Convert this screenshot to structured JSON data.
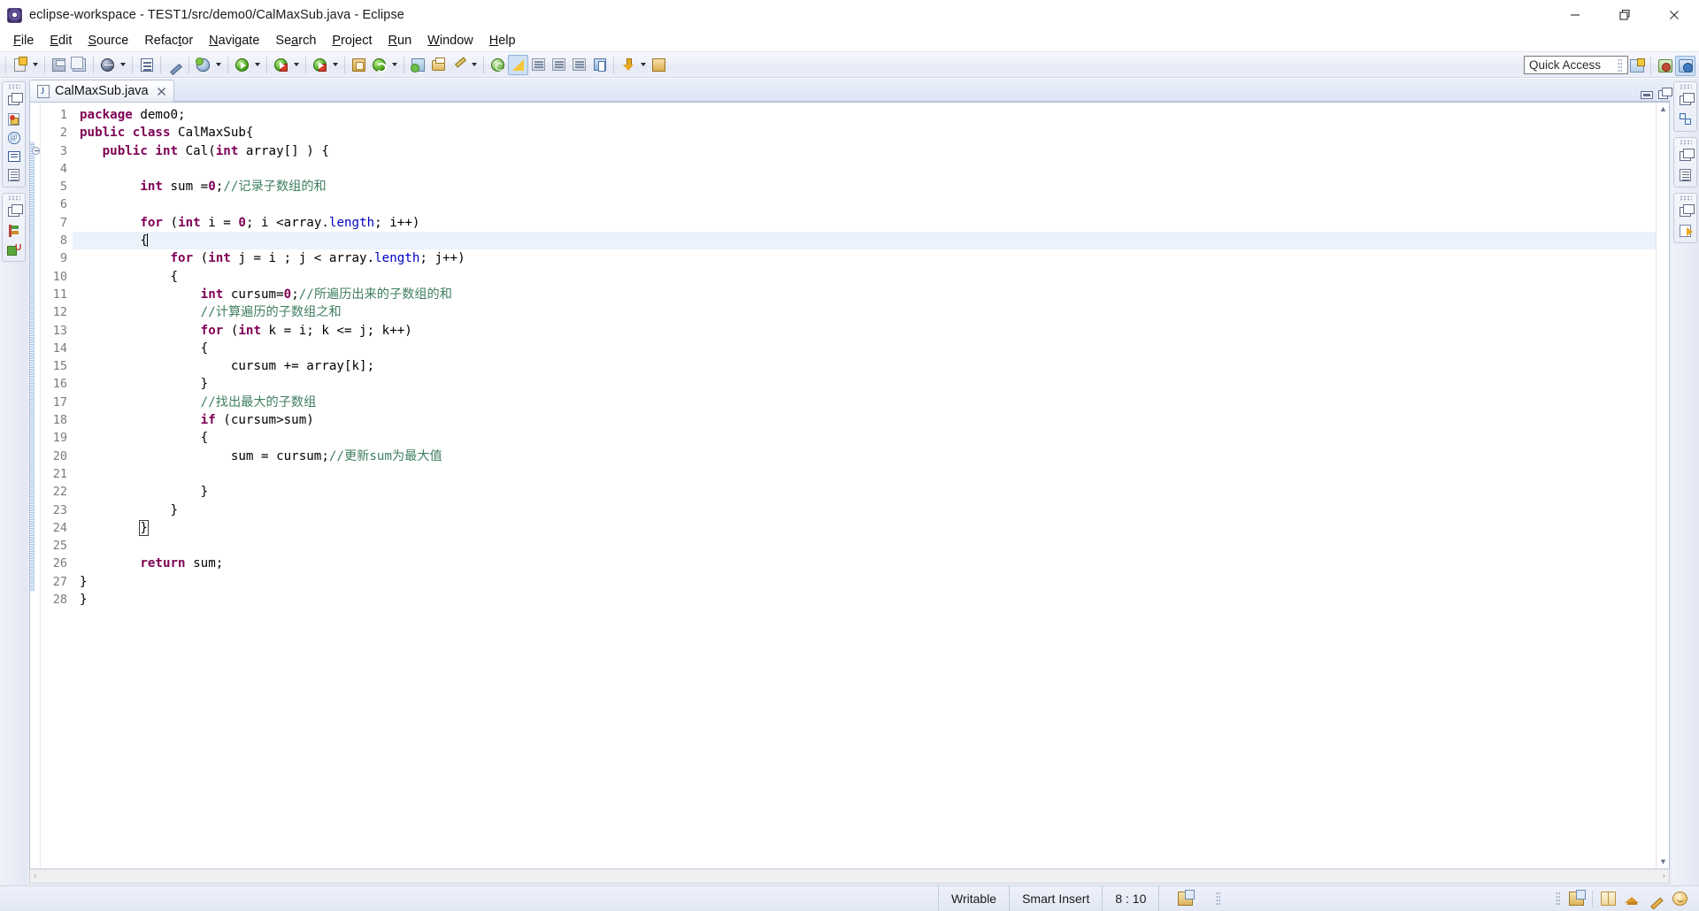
{
  "window": {
    "title": "eclipse-workspace - TEST1/src/demo0/CalMaxSub.java - Eclipse",
    "app_icon": "eclipse-icon",
    "controls": {
      "minimize": "minimize-icon",
      "restore": "restore-icon",
      "close": "close-icon"
    }
  },
  "menubar": {
    "items": [
      {
        "label": "File",
        "mnemonic": "F"
      },
      {
        "label": "Edit",
        "mnemonic": "E"
      },
      {
        "label": "Source",
        "mnemonic": "S"
      },
      {
        "label": "Refactor",
        "mnemonic": "t"
      },
      {
        "label": "Navigate",
        "mnemonic": "N"
      },
      {
        "label": "Search",
        "mnemonic": "a"
      },
      {
        "label": "Project",
        "mnemonic": "P"
      },
      {
        "label": "Run",
        "mnemonic": "R"
      },
      {
        "label": "Window",
        "mnemonic": "W"
      },
      {
        "label": "Help",
        "mnemonic": "H"
      }
    ]
  },
  "toolbar": {
    "buttons": [
      {
        "name": "new-wizard",
        "icon": "new-icon",
        "dropdown": true
      },
      {
        "name": "save",
        "icon": "save-icon",
        "dropdown": false
      },
      {
        "name": "save-all",
        "icon": "save-all-icon",
        "dropdown": false
      },
      {
        "name": "new-java-package-or-globe",
        "icon": "globe-icon",
        "dropdown": true
      },
      {
        "name": "open-type",
        "icon": "document-icon",
        "dropdown": false
      },
      {
        "name": "toggle-mark-occurrences",
        "icon": "pen-icon",
        "dropdown": false
      },
      {
        "name": "debug",
        "icon": "debug-bug-icon",
        "dropdown": true
      },
      {
        "name": "run",
        "icon": "run-green-play-icon",
        "dropdown": true
      },
      {
        "name": "run-coverage",
        "icon": "run-coverage-icon",
        "dropdown": true
      },
      {
        "name": "run-last-tool",
        "icon": "run-external-tools-icon",
        "dropdown": true
      },
      {
        "name": "new-java-project",
        "icon": "new-java-project-icon",
        "dropdown": false
      },
      {
        "name": "open-search",
        "icon": "search-orange-icon",
        "dropdown": true
      },
      {
        "name": "forward-refresh",
        "icon": "refresh-green-icon",
        "dropdown": false
      },
      {
        "name": "new-package",
        "icon": "package-icon",
        "dropdown": false
      },
      {
        "name": "print",
        "icon": "print-icon",
        "dropdown": false
      },
      {
        "name": "brush",
        "icon": "brush-icon",
        "dropdown": true
      },
      {
        "name": "toggle-breadcrumb",
        "icon": "breadcrumb-icon",
        "dropdown": false
      },
      {
        "name": "yellow-triangle-warning",
        "icon": "warning-triangle-icon",
        "dropdown": false
      },
      {
        "name": "skip-breakpoints",
        "icon": "skip-breakpoints-icon",
        "dropdown": false
      },
      {
        "name": "next-annotation",
        "icon": "next-annotation-icon",
        "dropdown": false
      },
      {
        "name": "previous-annotation",
        "icon": "previous-annotation-icon",
        "dropdown": false
      },
      {
        "name": "last-edit-location",
        "icon": "last-edit-location-icon",
        "dropdown": false
      },
      {
        "name": "back-history",
        "icon": "back-arrow-icon",
        "dropdown": true
      },
      {
        "name": "forward-history",
        "icon": "forward-arrow-icon",
        "dropdown": true
      }
    ],
    "quick_access": {
      "placeholder": "Quick Access",
      "value": "Quick Access"
    },
    "perspective_buttons": [
      {
        "name": "open-perspective",
        "icon": "open-perspective-icon"
      },
      {
        "name": "java-ee-perspective",
        "icon": "java-ee-perspective-icon"
      },
      {
        "name": "java-perspective",
        "icon": "java-perspective-icon",
        "selected": true
      }
    ]
  },
  "left_trim": {
    "stacks": [
      {
        "name": "package-explorer-stack",
        "items": [
          {
            "name": "restore-icon"
          },
          {
            "name": "package-explorer-icon"
          },
          {
            "name": "javadoc-icon"
          },
          {
            "name": "console-icon"
          },
          {
            "name": "outline-icon"
          }
        ]
      },
      {
        "name": "task-list-stack",
        "items": [
          {
            "name": "restore-icon"
          },
          {
            "name": "task-list-icon"
          },
          {
            "name": "junit-icon"
          }
        ]
      }
    ]
  },
  "right_trim": {
    "stacks": [
      {
        "name": "outline-stack",
        "items": [
          {
            "name": "restore-icon"
          },
          {
            "name": "type-hierarchy-icon"
          }
        ]
      },
      {
        "name": "problems-stack",
        "items": [
          {
            "name": "restore-icon"
          },
          {
            "name": "problems-icon"
          }
        ]
      },
      {
        "name": "export-stack",
        "items": [
          {
            "name": "restore-icon"
          },
          {
            "name": "export-icon"
          }
        ]
      }
    ]
  },
  "editor": {
    "tab": {
      "label": "CalMaxSub.java",
      "icon": "java-file-icon",
      "close": "✖",
      "dirty": false
    },
    "controls": {
      "minimize": "minimize-editor-icon",
      "maximize": "maximize-editor-icon"
    },
    "overview_ruler": {
      "up_arrow": "▲",
      "down_arrow": "▼"
    },
    "hscroll": {
      "left_arrow": "‹",
      "right_arrow": "›"
    },
    "current_line": 8,
    "caret_column": 10,
    "fold_marker_line": 3,
    "bracket_match_line": 24,
    "lines": [
      {
        "n": 1,
        "tokens": [
          {
            "t": "package",
            "c": "kw"
          },
          {
            "t": " demo0;",
            "c": "pln"
          }
        ]
      },
      {
        "n": 2,
        "tokens": [
          {
            "t": "public class",
            "c": "kw"
          },
          {
            "t": " CalMaxSub{",
            "c": "pln"
          }
        ]
      },
      {
        "n": 3,
        "tokens": [
          {
            "t": "   ",
            "c": "pln"
          },
          {
            "t": "public int",
            "c": "kw"
          },
          {
            "t": " Cal(",
            "c": "pln"
          },
          {
            "t": "int",
            "c": "kw"
          },
          {
            "t": " array[] ) {",
            "c": "pln"
          }
        ]
      },
      {
        "n": 4,
        "tokens": []
      },
      {
        "n": 5,
        "tokens": [
          {
            "t": "        ",
            "c": "pln"
          },
          {
            "t": "int",
            "c": "kw"
          },
          {
            "t": " sum =",
            "c": "pln"
          },
          {
            "t": "0",
            "c": "kw"
          },
          {
            "t": ";",
            "c": "pln"
          },
          {
            "t": "//记录子数组的和",
            "c": "cm"
          }
        ]
      },
      {
        "n": 6,
        "tokens": []
      },
      {
        "n": 7,
        "tokens": [
          {
            "t": "        ",
            "c": "pln"
          },
          {
            "t": "for",
            "c": "kw"
          },
          {
            "t": " (",
            "c": "pln"
          },
          {
            "t": "int",
            "c": "kw"
          },
          {
            "t": " i = ",
            "c": "pln"
          },
          {
            "t": "0",
            "c": "kw"
          },
          {
            "t": "; i <array.",
            "c": "pln"
          },
          {
            "t": "length",
            "c": "fld"
          },
          {
            "t": "; i++)",
            "c": "pln"
          }
        ]
      },
      {
        "n": 8,
        "tokens": [
          {
            "t": "        {",
            "c": "pln"
          }
        ],
        "caret_after": true,
        "current": true
      },
      {
        "n": 9,
        "tokens": [
          {
            "t": "            ",
            "c": "pln"
          },
          {
            "t": "for",
            "c": "kw"
          },
          {
            "t": " (",
            "c": "pln"
          },
          {
            "t": "int",
            "c": "kw"
          },
          {
            "t": " j = i ; j < array.",
            "c": "pln"
          },
          {
            "t": "length",
            "c": "fld"
          },
          {
            "t": "; j++)",
            "c": "pln"
          }
        ]
      },
      {
        "n": 10,
        "tokens": [
          {
            "t": "            {",
            "c": "pln"
          }
        ]
      },
      {
        "n": 11,
        "tokens": [
          {
            "t": "                ",
            "c": "pln"
          },
          {
            "t": "int",
            "c": "kw"
          },
          {
            "t": " cursum=",
            "c": "pln"
          },
          {
            "t": "0",
            "c": "kw"
          },
          {
            "t": ";",
            "c": "pln"
          },
          {
            "t": "//所遍历出来的子数组的和",
            "c": "cm"
          }
        ]
      },
      {
        "n": 12,
        "tokens": [
          {
            "t": "                ",
            "c": "pln"
          },
          {
            "t": "//计算遍历的子数组之和",
            "c": "cm"
          }
        ]
      },
      {
        "n": 13,
        "tokens": [
          {
            "t": "                ",
            "c": "pln"
          },
          {
            "t": "for",
            "c": "kw"
          },
          {
            "t": " (",
            "c": "pln"
          },
          {
            "t": "int",
            "c": "kw"
          },
          {
            "t": " k = i; k <= j; k++)",
            "c": "pln"
          }
        ]
      },
      {
        "n": 14,
        "tokens": [
          {
            "t": "                {",
            "c": "pln"
          }
        ]
      },
      {
        "n": 15,
        "tokens": [
          {
            "t": "                    cursum += array[k];",
            "c": "pln"
          }
        ]
      },
      {
        "n": 16,
        "tokens": [
          {
            "t": "                }",
            "c": "pln"
          }
        ]
      },
      {
        "n": 17,
        "tokens": [
          {
            "t": "                ",
            "c": "pln"
          },
          {
            "t": "//找出最大的子数组",
            "c": "cm"
          }
        ]
      },
      {
        "n": 18,
        "tokens": [
          {
            "t": "                ",
            "c": "pln"
          },
          {
            "t": "if",
            "c": "kw"
          },
          {
            "t": " (cursum>sum)",
            "c": "pln"
          }
        ]
      },
      {
        "n": 19,
        "tokens": [
          {
            "t": "                {",
            "c": "pln"
          }
        ]
      },
      {
        "n": 20,
        "tokens": [
          {
            "t": "                    sum = cursum;",
            "c": "pln"
          },
          {
            "t": "//更新sum为最大值",
            "c": "cm"
          }
        ]
      },
      {
        "n": 21,
        "tokens": []
      },
      {
        "n": 22,
        "tokens": [
          {
            "t": "                }",
            "c": "pln"
          }
        ]
      },
      {
        "n": 23,
        "tokens": [
          {
            "t": "            }",
            "c": "pln"
          }
        ]
      },
      {
        "n": 24,
        "tokens": [
          {
            "t": "        ",
            "c": "pln"
          },
          {
            "t": "}",
            "c": "pln",
            "match": true
          }
        ]
      },
      {
        "n": 25,
        "tokens": []
      },
      {
        "n": 26,
        "tokens": [
          {
            "t": "        ",
            "c": "pln"
          },
          {
            "t": "return",
            "c": "kw"
          },
          {
            "t": " sum;",
            "c": "pln"
          }
        ]
      },
      {
        "n": 27,
        "tokens": [
          {
            "t": "}",
            "c": "pln"
          }
        ]
      },
      {
        "n": 28,
        "tokens": [
          {
            "t": "}",
            "c": "pln"
          }
        ]
      }
    ]
  },
  "statusbar": {
    "writable": "Writable",
    "insert_mode": "Smart Insert",
    "position": "8 : 10",
    "sync_icon": "sync-icon",
    "right_icons": [
      {
        "name": "sync-icon"
      },
      {
        "name": "book-icon"
      },
      {
        "name": "graduation-cap-icon"
      },
      {
        "name": "pencil-icon"
      },
      {
        "name": "smiley-icon"
      }
    ]
  },
  "colors": {
    "keyword": "#7f0055",
    "comment": "#3f7f5f",
    "field": "#0000c0",
    "current_line_bg": "#eaf2fb",
    "accent": "#cfe0f5"
  }
}
